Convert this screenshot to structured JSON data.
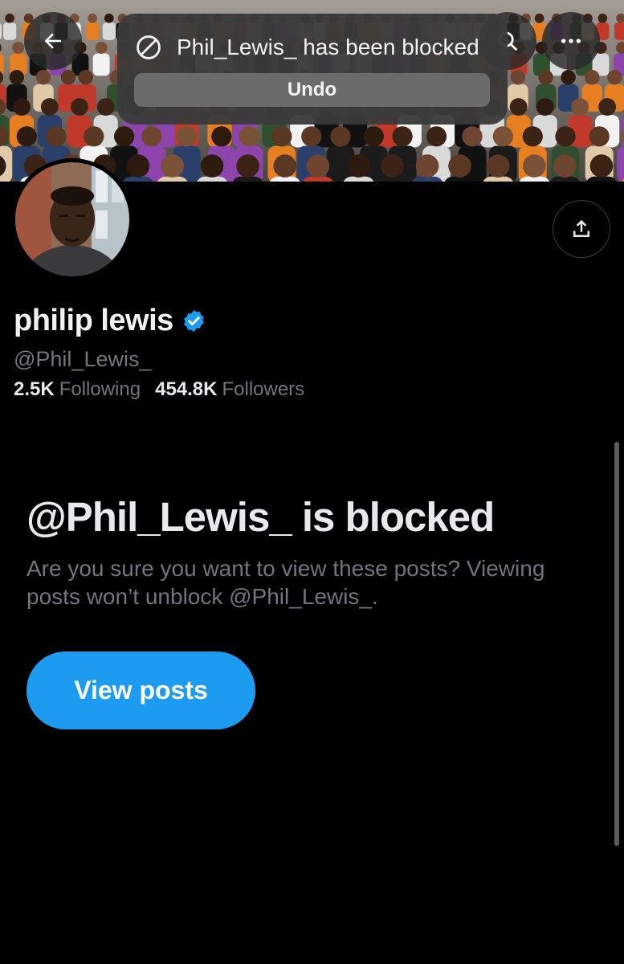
{
  "header": {
    "back_icon": "arrow-left-icon",
    "search_icon": "search-icon",
    "more_icon": "more-horizontal-icon"
  },
  "toast": {
    "icon": "blocked-icon",
    "message": "Phil_Lewis_ has been blocked",
    "undo_label": "Undo"
  },
  "profile": {
    "name": "philip lewis",
    "verified": true,
    "handle": "@Phil_Lewis_",
    "following_count": "2.5K",
    "following_label": "Following",
    "followers_count": "454.8K",
    "followers_label": "Followers",
    "share_icon": "share-icon"
  },
  "blocked": {
    "title": "@Phil_Lewis_ is blocked",
    "description": "Are you sure you want to view these posts? Viewing posts won’t unblock @Phil_Lewis_.",
    "view_posts_label": "View posts"
  },
  "colors": {
    "accent": "#1d9bf0",
    "background": "#000000",
    "muted_text": "#71767b"
  }
}
